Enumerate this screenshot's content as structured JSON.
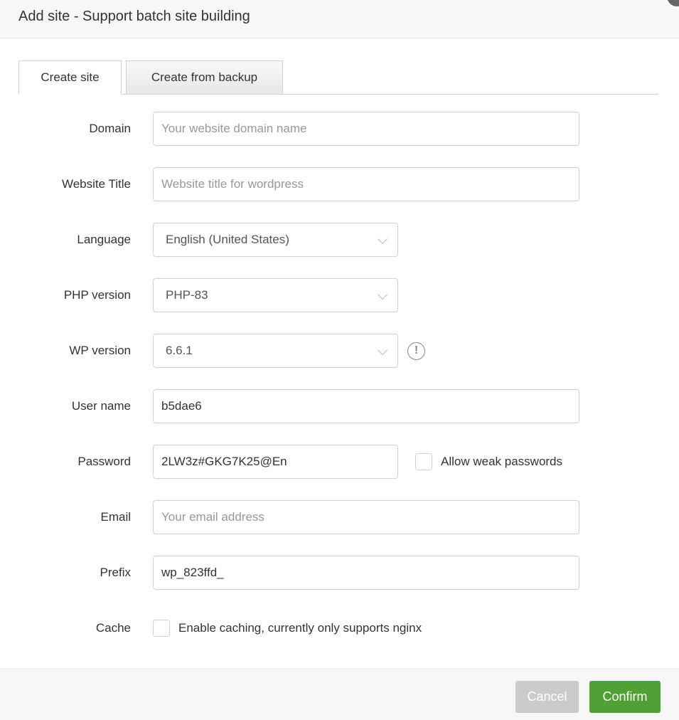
{
  "dialog": {
    "title": "Add site - Support batch site building"
  },
  "tabs": [
    {
      "label": "Create site",
      "active": true
    },
    {
      "label": "Create from backup",
      "active": false
    }
  ],
  "form": {
    "domain": {
      "label": "Domain",
      "value": "",
      "placeholder": "Your website domain name"
    },
    "website_title": {
      "label": "Website Title",
      "value": "",
      "placeholder": "Website title for wordpress"
    },
    "language": {
      "label": "Language",
      "selected": "English (United States)"
    },
    "php_version": {
      "label": "PHP version",
      "selected": "PHP-83"
    },
    "wp_version": {
      "label": "WP version",
      "selected": "6.6.1",
      "info_icon": "!"
    },
    "user_name": {
      "label": "User name",
      "value": "b5dae6"
    },
    "password": {
      "label": "Password",
      "value": "2LW3z#GKG7K25@En",
      "allow_weak_label": "Allow weak passwords",
      "allow_weak_checked": false
    },
    "email": {
      "label": "Email",
      "value": "",
      "placeholder": "Your email address"
    },
    "prefix": {
      "label": "Prefix",
      "value": "wp_823ffd_"
    },
    "cache": {
      "label": "Cache",
      "checkbox_label": "Enable caching, currently only supports nginx",
      "checked": false
    }
  },
  "footer": {
    "cancel_label": "Cancel",
    "confirm_label": "Confirm"
  },
  "colors": {
    "confirm": "#4ea132",
    "cancel": "#cbcbcb"
  }
}
